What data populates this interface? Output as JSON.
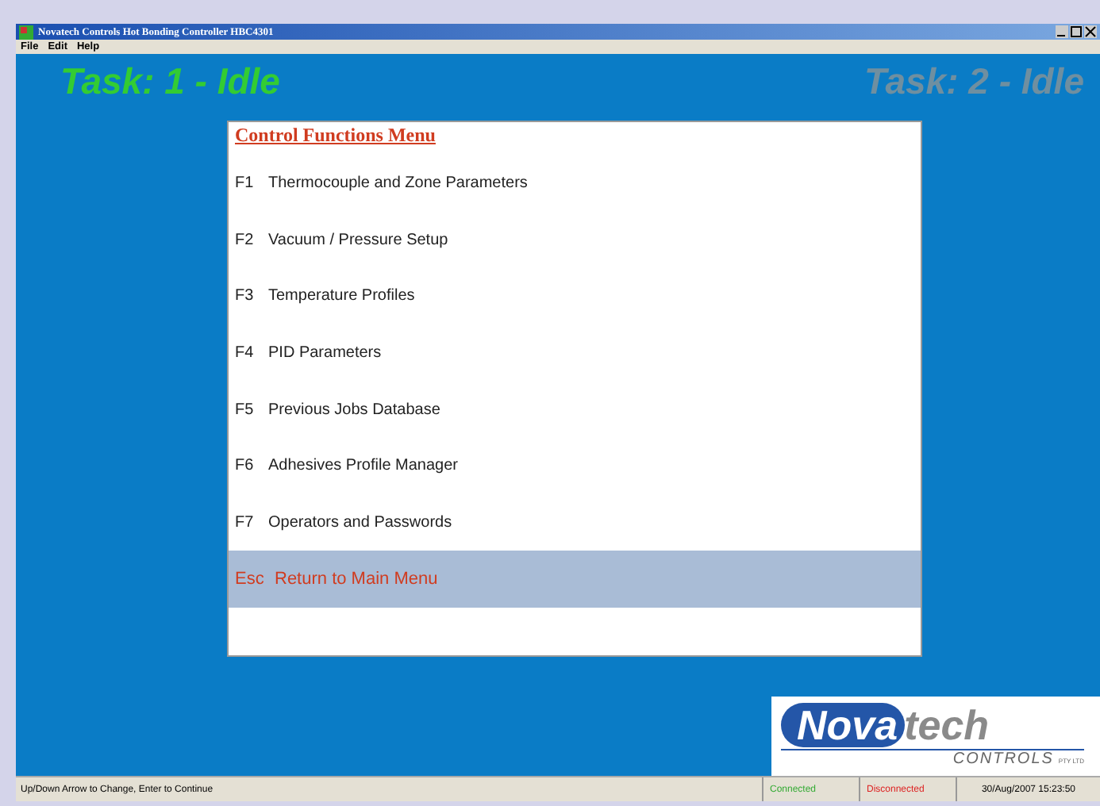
{
  "window": {
    "title": "Novatech Controls Hot Bonding Controller HBC4301"
  },
  "menubar": [
    "File",
    "Edit",
    "Help"
  ],
  "tasks": [
    {
      "label": "Task: 1 - Idle",
      "color": "#33cc33"
    },
    {
      "label": "Task: 2 - Idle",
      "color": "#6f8fa0"
    }
  ],
  "menu": {
    "title": "Control Functions Menu",
    "items": [
      {
        "key": "F1",
        "label": "Thermocouple and Zone Parameters",
        "selected": false
      },
      {
        "key": "F2",
        "label": "Vacuum / Pressure Setup",
        "selected": false
      },
      {
        "key": "F3",
        "label": "Temperature Profiles",
        "selected": false
      },
      {
        "key": "F4",
        "label": "PID Parameters",
        "selected": false
      },
      {
        "key": "F5",
        "label": "Previous Jobs Database",
        "selected": false
      },
      {
        "key": "F6",
        "label": "Adhesives Profile Manager",
        "selected": false
      },
      {
        "key": "F7",
        "label": "Operators  and Passwords",
        "selected": false
      },
      {
        "key": "Esc",
        "label": "Return to Main Menu",
        "selected": true
      }
    ]
  },
  "logo": {
    "name_part1": "Nova",
    "name_part2": "tech",
    "sub": "CONTROLS",
    "suffix": "PTY LTD"
  },
  "status_bar": {
    "hint": "Up/Down Arrow to Change,  Enter to Continue",
    "connections": [
      {
        "label": "Connected",
        "color": "#33aa33"
      },
      {
        "label": "Disconnected",
        "color": "#dd2222"
      }
    ],
    "datetime": "30/Aug/2007  15:23:50"
  }
}
